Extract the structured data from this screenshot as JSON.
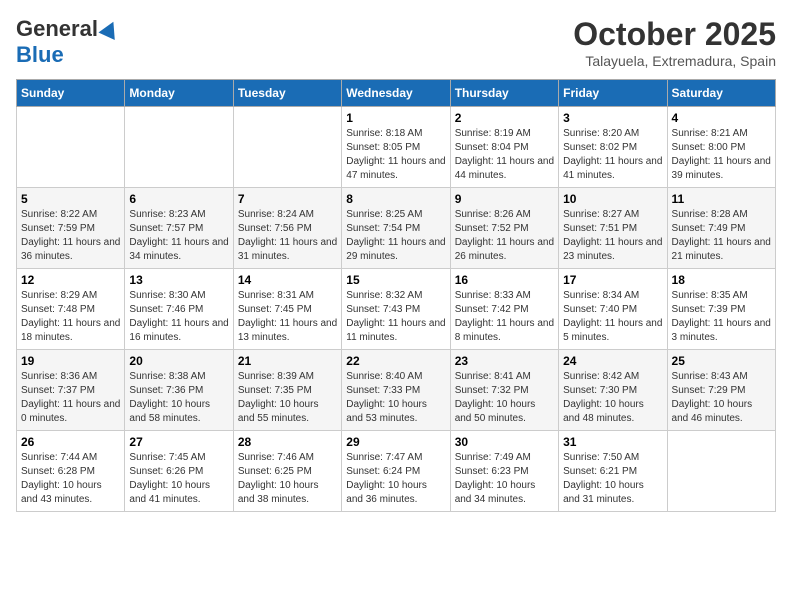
{
  "header": {
    "logo_general": "General",
    "logo_blue": "Blue",
    "month": "October 2025",
    "location": "Talayuela, Extremadura, Spain"
  },
  "weekdays": [
    "Sunday",
    "Monday",
    "Tuesday",
    "Wednesday",
    "Thursday",
    "Friday",
    "Saturday"
  ],
  "weeks": [
    [
      {
        "day": "",
        "info": ""
      },
      {
        "day": "",
        "info": ""
      },
      {
        "day": "",
        "info": ""
      },
      {
        "day": "1",
        "info": "Sunrise: 8:18 AM\nSunset: 8:05 PM\nDaylight: 11 hours and 47 minutes."
      },
      {
        "day": "2",
        "info": "Sunrise: 8:19 AM\nSunset: 8:04 PM\nDaylight: 11 hours and 44 minutes."
      },
      {
        "day": "3",
        "info": "Sunrise: 8:20 AM\nSunset: 8:02 PM\nDaylight: 11 hours and 41 minutes."
      },
      {
        "day": "4",
        "info": "Sunrise: 8:21 AM\nSunset: 8:00 PM\nDaylight: 11 hours and 39 minutes."
      }
    ],
    [
      {
        "day": "5",
        "info": "Sunrise: 8:22 AM\nSunset: 7:59 PM\nDaylight: 11 hours and 36 minutes."
      },
      {
        "day": "6",
        "info": "Sunrise: 8:23 AM\nSunset: 7:57 PM\nDaylight: 11 hours and 34 minutes."
      },
      {
        "day": "7",
        "info": "Sunrise: 8:24 AM\nSunset: 7:56 PM\nDaylight: 11 hours and 31 minutes."
      },
      {
        "day": "8",
        "info": "Sunrise: 8:25 AM\nSunset: 7:54 PM\nDaylight: 11 hours and 29 minutes."
      },
      {
        "day": "9",
        "info": "Sunrise: 8:26 AM\nSunset: 7:52 PM\nDaylight: 11 hours and 26 minutes."
      },
      {
        "day": "10",
        "info": "Sunrise: 8:27 AM\nSunset: 7:51 PM\nDaylight: 11 hours and 23 minutes."
      },
      {
        "day": "11",
        "info": "Sunrise: 8:28 AM\nSunset: 7:49 PM\nDaylight: 11 hours and 21 minutes."
      }
    ],
    [
      {
        "day": "12",
        "info": "Sunrise: 8:29 AM\nSunset: 7:48 PM\nDaylight: 11 hours and 18 minutes."
      },
      {
        "day": "13",
        "info": "Sunrise: 8:30 AM\nSunset: 7:46 PM\nDaylight: 11 hours and 16 minutes."
      },
      {
        "day": "14",
        "info": "Sunrise: 8:31 AM\nSunset: 7:45 PM\nDaylight: 11 hours and 13 minutes."
      },
      {
        "day": "15",
        "info": "Sunrise: 8:32 AM\nSunset: 7:43 PM\nDaylight: 11 hours and 11 minutes."
      },
      {
        "day": "16",
        "info": "Sunrise: 8:33 AM\nSunset: 7:42 PM\nDaylight: 11 hours and 8 minutes."
      },
      {
        "day": "17",
        "info": "Sunrise: 8:34 AM\nSunset: 7:40 PM\nDaylight: 11 hours and 5 minutes."
      },
      {
        "day": "18",
        "info": "Sunrise: 8:35 AM\nSunset: 7:39 PM\nDaylight: 11 hours and 3 minutes."
      }
    ],
    [
      {
        "day": "19",
        "info": "Sunrise: 8:36 AM\nSunset: 7:37 PM\nDaylight: 11 hours and 0 minutes."
      },
      {
        "day": "20",
        "info": "Sunrise: 8:38 AM\nSunset: 7:36 PM\nDaylight: 10 hours and 58 minutes."
      },
      {
        "day": "21",
        "info": "Sunrise: 8:39 AM\nSunset: 7:35 PM\nDaylight: 10 hours and 55 minutes."
      },
      {
        "day": "22",
        "info": "Sunrise: 8:40 AM\nSunset: 7:33 PM\nDaylight: 10 hours and 53 minutes."
      },
      {
        "day": "23",
        "info": "Sunrise: 8:41 AM\nSunset: 7:32 PM\nDaylight: 10 hours and 50 minutes."
      },
      {
        "day": "24",
        "info": "Sunrise: 8:42 AM\nSunset: 7:30 PM\nDaylight: 10 hours and 48 minutes."
      },
      {
        "day": "25",
        "info": "Sunrise: 8:43 AM\nSunset: 7:29 PM\nDaylight: 10 hours and 46 minutes."
      }
    ],
    [
      {
        "day": "26",
        "info": "Sunrise: 7:44 AM\nSunset: 6:28 PM\nDaylight: 10 hours and 43 minutes."
      },
      {
        "day": "27",
        "info": "Sunrise: 7:45 AM\nSunset: 6:26 PM\nDaylight: 10 hours and 41 minutes."
      },
      {
        "day": "28",
        "info": "Sunrise: 7:46 AM\nSunset: 6:25 PM\nDaylight: 10 hours and 38 minutes."
      },
      {
        "day": "29",
        "info": "Sunrise: 7:47 AM\nSunset: 6:24 PM\nDaylight: 10 hours and 36 minutes."
      },
      {
        "day": "30",
        "info": "Sunrise: 7:49 AM\nSunset: 6:23 PM\nDaylight: 10 hours and 34 minutes."
      },
      {
        "day": "31",
        "info": "Sunrise: 7:50 AM\nSunset: 6:21 PM\nDaylight: 10 hours and 31 minutes."
      },
      {
        "day": "",
        "info": ""
      }
    ]
  ]
}
